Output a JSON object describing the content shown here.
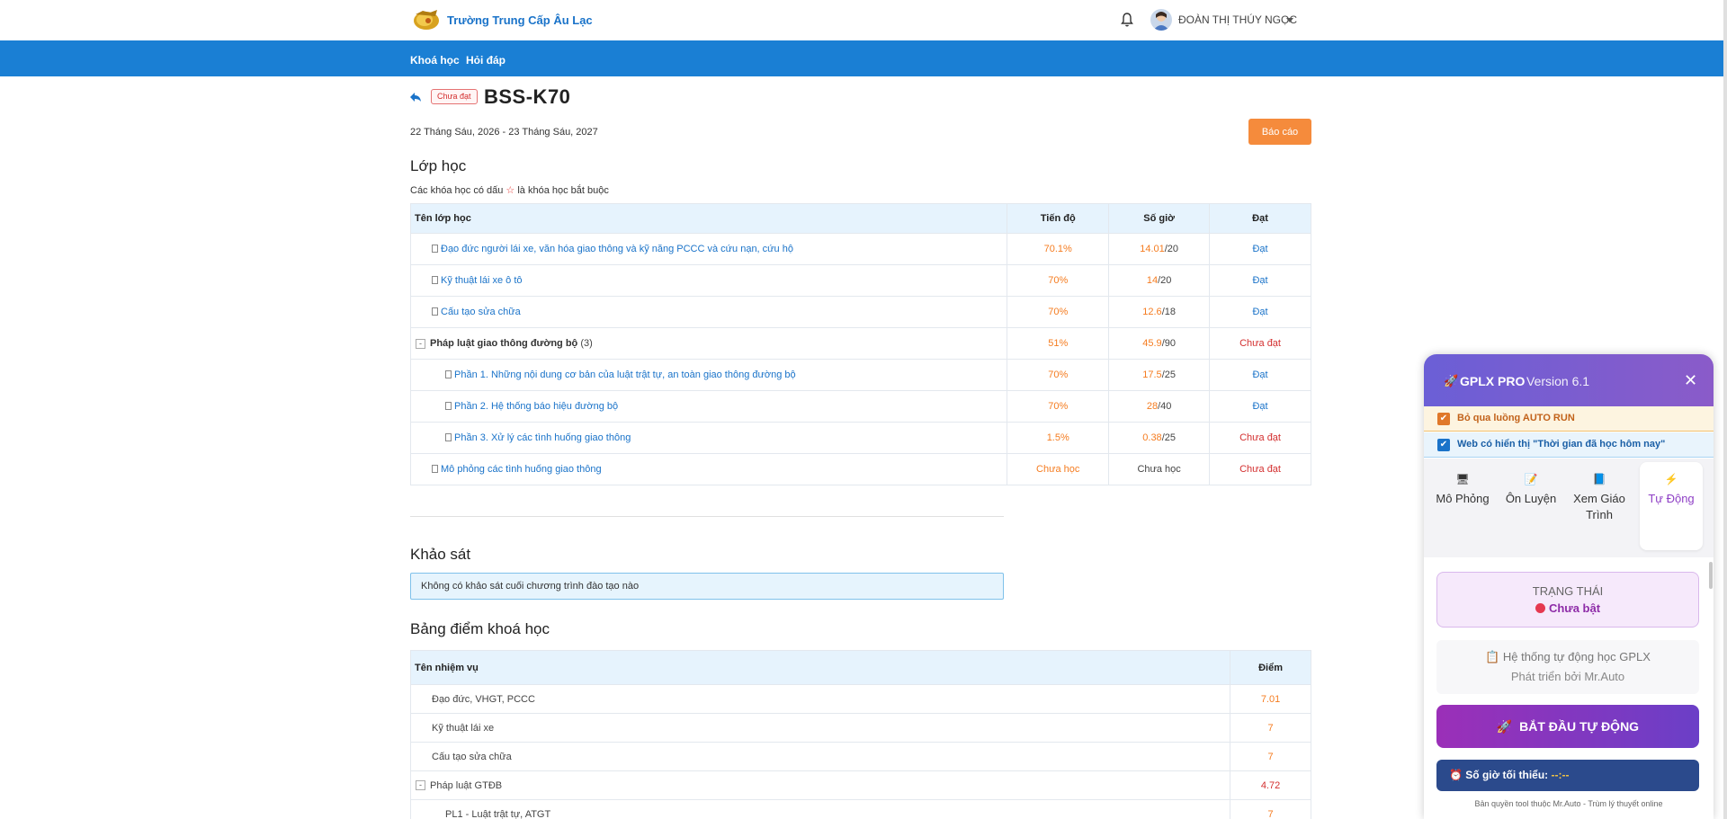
{
  "header": {
    "brand": "Trường Trung Cấp Âu Lạc",
    "user_name": "ĐOÀN THỊ THÚY NGỌC"
  },
  "nav": {
    "items": [
      "Khoá học",
      "Hỏi đáp"
    ]
  },
  "course": {
    "status_badge": "Chưa đạt",
    "title": "BSS-K70",
    "date_range": "22 Tháng Sáu, 2026 - 23 Tháng Sáu, 2027",
    "report_button": "Báo cáo"
  },
  "classes": {
    "section_title": "Lớp học",
    "note_before": "Các khóa học có dấu",
    "note_star": "☆",
    "note_after": "là khóa học bắt buộc",
    "columns": [
      "Tên lớp học",
      "Tiến độ",
      "Số giờ",
      "Đạt"
    ],
    "rows": [
      {
        "name": "Đạo đức người lái xe, văn hóa giao thông và kỹ năng PCCC và cứu nạn, cứu hộ",
        "progress": "70.1%",
        "hours_done": "14.01",
        "hours_total": "/20",
        "result": "Đạt",
        "level": 1
      },
      {
        "name": "Kỹ thuật lái xe ô tô",
        "progress": "70%",
        "hours_done": "14",
        "hours_total": "/20",
        "result": "Đạt",
        "level": 1
      },
      {
        "name": "Cấu tạo sửa chữa",
        "progress": "70%",
        "hours_done": "12.6",
        "hours_total": "/18",
        "result": "Đạt",
        "level": 1
      },
      {
        "name": "Pháp luật giao thông đường bộ",
        "count": "(3)",
        "progress": "51%",
        "hours_done": "45.9",
        "hours_total": "/90",
        "result": "Chưa đạt",
        "level": 0
      },
      {
        "name": "Phần 1. Những nội dung cơ bản của luật trật tự, an toàn giao thông đường bộ",
        "progress": "70%",
        "hours_done": "17.5",
        "hours_total": "/25",
        "result": "Đạt",
        "level": 2
      },
      {
        "name": "Phần 2. Hệ thống báo hiệu đường bộ",
        "progress": "70%",
        "hours_done": "28",
        "hours_total": "/40",
        "result": "Đạt",
        "level": 2
      },
      {
        "name": "Phần 3. Xử lý các tình huống giao thông",
        "progress": "1.5%",
        "hours_done": "0.38",
        "hours_total": "/25",
        "result": "Chưa đạt",
        "level": 2
      },
      {
        "name": "Mô phỏng các tình huống giao thông",
        "progress": "Chưa học",
        "hours_text": "Chưa học",
        "result": "Chưa đạt",
        "level": 1
      }
    ]
  },
  "survey": {
    "section_title": "Khảo sát",
    "message": "Không có khảo sát cuối chương trình đào tạo nào"
  },
  "scores": {
    "section_title": "Bảng điểm khoá học",
    "columns": [
      "Tên nhiệm vụ",
      "Điểm"
    ],
    "rows": [
      {
        "name": "Đạo đức, VHGT, PCCC",
        "score": "7.01"
      },
      {
        "name": "Kỹ thuật lái xe",
        "score": "7"
      },
      {
        "name": "Cấu tạo sửa chữa",
        "score": "7"
      },
      {
        "name": "Pháp luật GTĐB",
        "score": "4.72"
      },
      {
        "name": "PL1 - Luật trật tự, ATGT",
        "score": "7"
      }
    ]
  },
  "gplx_panel": {
    "name": "GPLX PRO",
    "version": "Version 6.1",
    "option1": "Bỏ qua luồng AUTO RUN",
    "option2": "Web có hiển thị \"Thời gian đã học hôm nay\"",
    "tabs": [
      {
        "label": "Mô Phỏng",
        "icon": "monitor-icon"
      },
      {
        "label": "Ôn Luyện",
        "icon": "notepad-icon"
      },
      {
        "label": "Xem Giáo Trình",
        "icon": "book-icon"
      },
      {
        "label": "Tự Động",
        "icon": "lightning-icon"
      }
    ],
    "status_label": "TRẠNG THÁI",
    "status_value": "Chưa bật",
    "info_line1": "Hệ thống tự động học GPLX",
    "info_line2": "Phát triển bởi Mr.Auto",
    "start_button": "BẮT ĐẦU TỰ ĐỘNG",
    "min_hours_label": "Số giờ tối thiểu:",
    "min_hours_value": "--:--",
    "copyright": "Bản quyền tool thuộc Mr.Auto - Trùm lý thuyết online"
  }
}
